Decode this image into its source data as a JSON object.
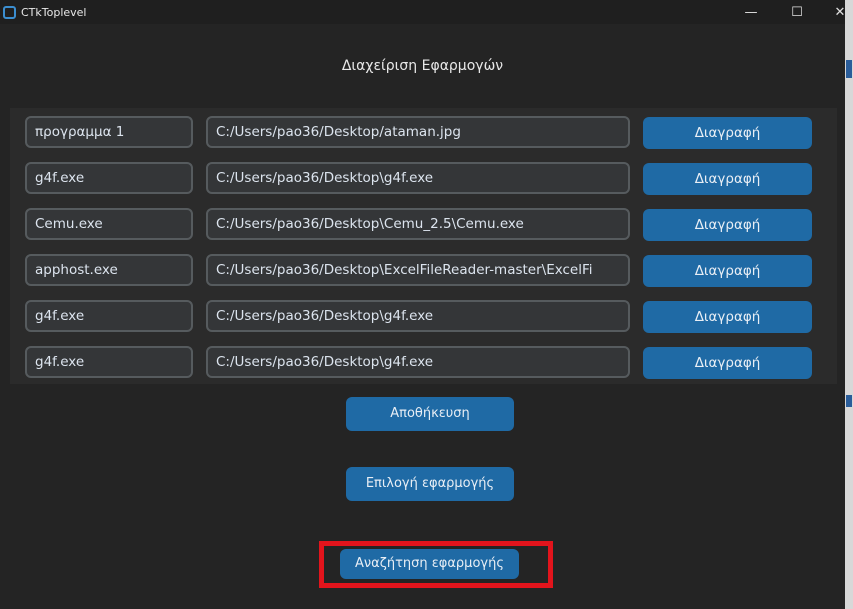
{
  "window": {
    "title": "CTkToplevel",
    "controls": {
      "minimize": "—",
      "maximize": "☐",
      "close": "✕"
    }
  },
  "page": {
    "title": "Διαχείριση Εφαρμογών"
  },
  "apps": [
    {
      "name": "προγραμμα 1",
      "path": "C:/Users/pao36/Desktop/ataman.jpg",
      "delete_label": "Διαγραφή"
    },
    {
      "name": "g4f.exe",
      "path": "C:/Users/pao36/Desktop\\g4f.exe",
      "delete_label": "Διαγραφή"
    },
    {
      "name": "Cemu.exe",
      "path": "C:/Users/pao36/Desktop\\Cemu_2.5\\Cemu.exe",
      "delete_label": "Διαγραφή"
    },
    {
      "name": "apphost.exe",
      "path": "C:/Users/pao36/Desktop\\ExcelFileReader-master\\ExcelFi",
      "delete_label": "Διαγραφή"
    },
    {
      "name": "g4f.exe",
      "path": "C:/Users/pao36/Desktop\\g4f.exe",
      "delete_label": "Διαγραφή"
    },
    {
      "name": "g4f.exe",
      "path": "C:/Users/pao36/Desktop\\g4f.exe",
      "delete_label": "Διαγραφή"
    }
  ],
  "actions": {
    "save_label": "Αποθήκευση",
    "select_label": "Επιλογή εφαρμογής",
    "search_label": "Αναζήτηση εφαρμογής"
  },
  "colors": {
    "background": "#242424",
    "button": "#1f6aa5",
    "highlight": "#e2141c"
  }
}
